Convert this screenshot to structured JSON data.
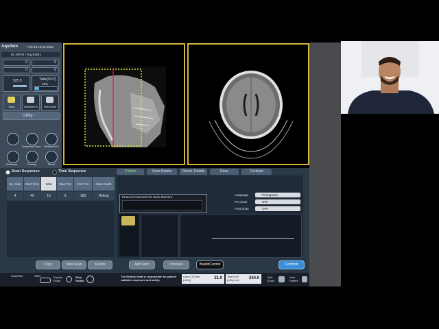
{
  "app": {
    "name": "Aquilion",
    "date": "Feb 29 15:23 2022"
  },
  "left_panel": {
    "study_line": "Ex.18700 / Img.81821",
    "counter_a": "0",
    "counter_b": "0",
    "counter_c": "0",
    "counter_d": "0",
    "kv_value": "525.5",
    "tube_label": "Tube(OLP)",
    "tube_pct": "18%",
    "tube_fill": 0.18,
    "btn_scan": "Scan",
    "btn_autoview": "Autoview &",
    "btn_rawdata": "Raw Data",
    "utility": "Utility",
    "icon_labels": [
      "",
      "Snapshot Save",
      "Window/Cur",
      "Windows",
      "Filming",
      "Reset"
    ]
  },
  "scan_sequence": {
    "radio1": "Scan Sequence",
    "radio2": "Time Sequence",
    "headers": [
      "No. Start",
      "Start Time",
      "Wait",
      "Start Pos",
      "End Pos",
      "Scan Mode"
    ],
    "row": [
      "4",
      "40",
      "15",
      "0",
      "180",
      "Helical"
    ]
  },
  "tabs": [
    "Patient",
    "Scan Details",
    "Recon. Details",
    "Dose",
    "Contrast"
  ],
  "protocol": {
    "comment_label": "Protocol Comment for Scan Element"
  },
  "settings": {
    "language_label": "Language",
    "language_value": "Portuguese",
    "pre_scan_label": "Pre Scan",
    "pre_scan_value": "OFF",
    "post_scan_label": "Post Scan",
    "post_scan_value": "OFF"
  },
  "footer_buttons": [
    "Copy",
    "New Scan",
    "Delete",
    "Add Scan",
    "Previous",
    "BreathControl"
  ],
  "confirm": "Confirm",
  "status": {
    "scanplan": "ScanPlan",
    "vmn": "VMN",
    "expose": "Expose Exam",
    "stop": "Stop Rotate",
    "notice": "The Medical staff is responsible for patient radiation exposure and safety.",
    "ctdi_label": "Cum.CTDIvol (mGy)",
    "ctdi_value": "21.0",
    "dlp_label": "Total DLP (mGy·cm)",
    "dlp_value": "244.0",
    "quit": "Quit Exam",
    "next": "Next Patient"
  },
  "colors": {
    "viewport_border": "#d6b63b",
    "confirm": "#3a8fd8",
    "scanline": "#e0203a",
    "roi": "#e6e23a"
  }
}
